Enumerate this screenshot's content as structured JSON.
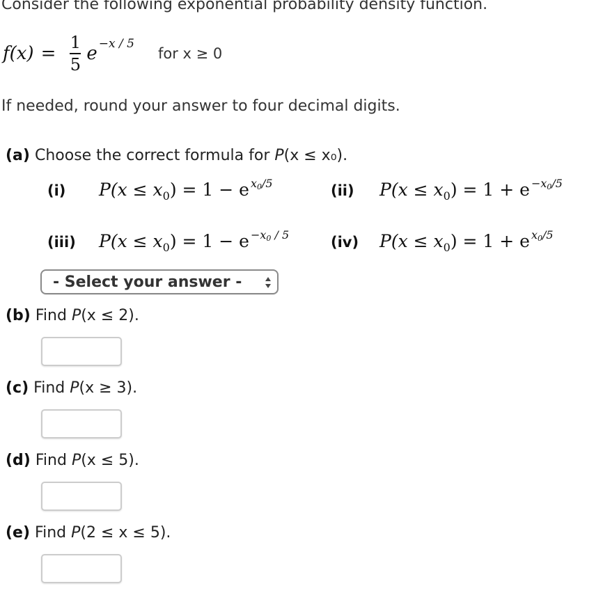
{
  "intro": "Consider the following exponential probability density function.",
  "pdf": {
    "lhs": "f(x)",
    "equals": "=",
    "numerator": "1",
    "denominator": "5",
    "base": "e",
    "exponent": "−x / 5",
    "domain": "for x ≥ 0"
  },
  "note": "If needed, round your answer to four decimal digits.",
  "parts": {
    "a": {
      "label": "(a)",
      "text_before": "Choose the correct formula for ",
      "prob": "P",
      "text_after": "(x ≤ x₀).",
      "options": [
        {
          "label": "(i)",
          "lhs": "P(x ≤ x",
          "sub": "0",
          "mid": ") = 1 − e",
          "exp": "x",
          "exp_sub": "0",
          "exp_tail": "/5"
        },
        {
          "label": "(ii)",
          "lhs": "P(x ≤ x",
          "sub": "0",
          "mid": ") = 1 + e",
          "exp": "−x",
          "exp_sub": "0",
          "exp_tail": "/5"
        },
        {
          "label": "(iii)",
          "lhs": "P(x ≤ x",
          "sub": "0",
          "mid": ") = 1 − e",
          "exp": "−x",
          "exp_sub": "0",
          "exp_tail": " / 5"
        },
        {
          "label": "(iv)",
          "lhs": "P(x ≤ x",
          "sub": "0",
          "mid": ") = 1 + e",
          "exp": "x",
          "exp_sub": "0",
          "exp_tail": "/5"
        }
      ],
      "select": {
        "value": "- Select your answer -"
      }
    },
    "b": {
      "label": "(b)",
      "text": "Find ",
      "prob": "P",
      "expr": "(x ≤ 2).",
      "answer": ""
    },
    "c": {
      "label": "(c)",
      "text": "Find ",
      "prob": "P",
      "expr": "(x ≥ 3).",
      "answer": ""
    },
    "d": {
      "label": "(d)",
      "text": "Find ",
      "prob": "P",
      "expr": "(x ≤ 5).",
      "answer": ""
    },
    "e": {
      "label": "(e)",
      "text": "Find ",
      "prob": "P",
      "expr": "(2 ≤ x ≤ 5).",
      "answer": ""
    }
  }
}
